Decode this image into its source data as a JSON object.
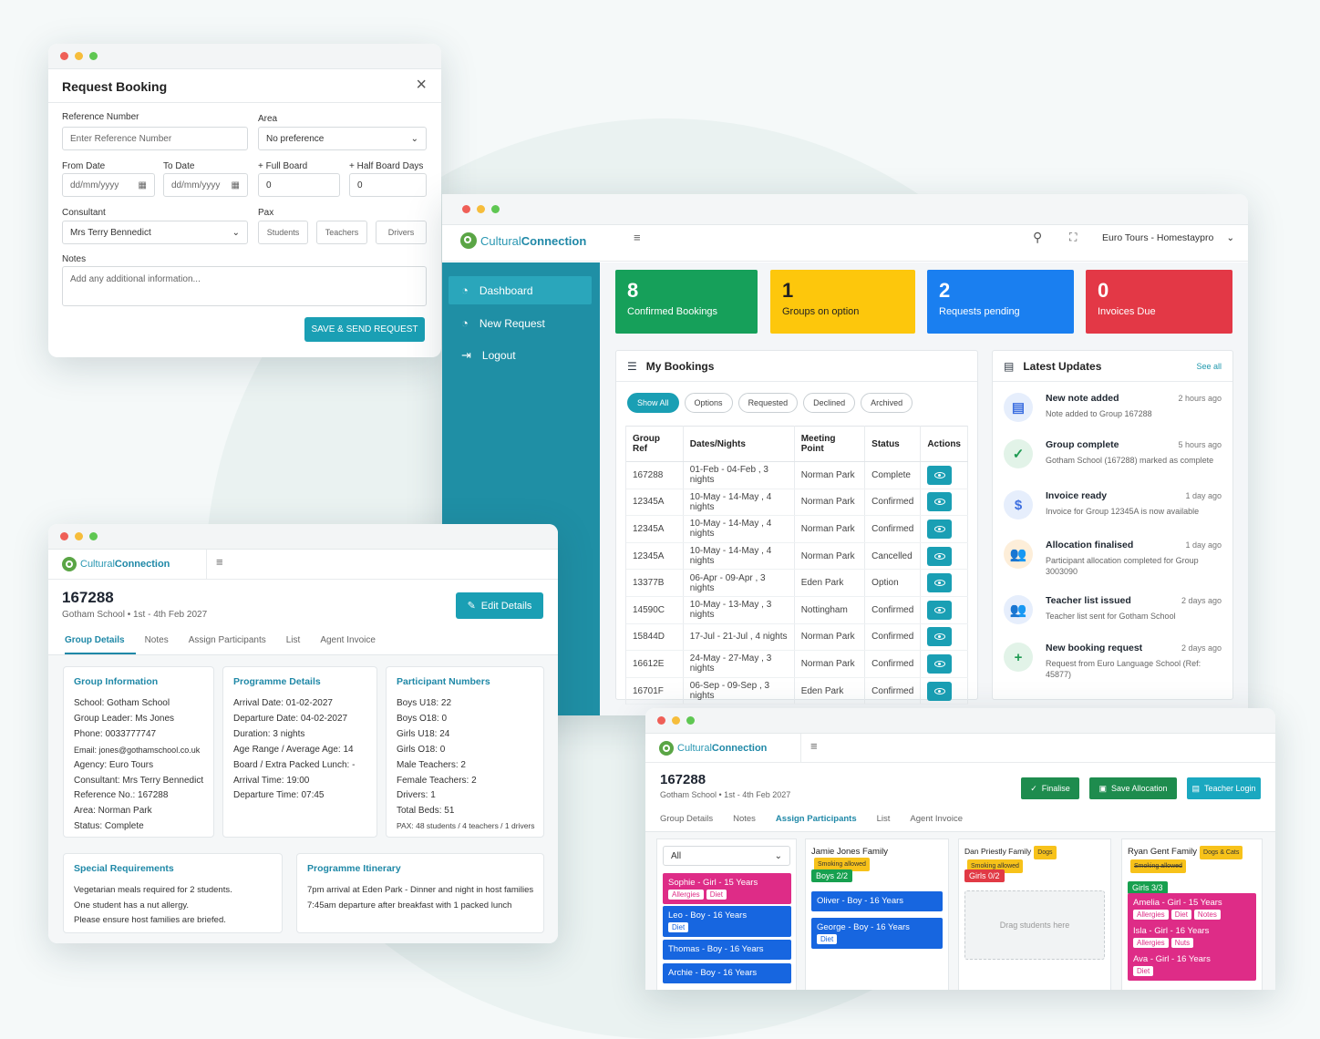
{
  "booking_form": {
    "title": "Request Booking",
    "ref_label": "Reference Number",
    "ref_placeholder": "Enter Reference Number",
    "area_label": "Area",
    "area_value": "No preference",
    "from_label": "From Date",
    "from_placeholder": "dd/mm/yyyy",
    "to_label": "To Date",
    "to_placeholder": "dd/mm/yyyy",
    "full_board_label": "+ Full Board",
    "full_board_value": "0",
    "half_board_label": "+ Half Board Days",
    "half_board_value": "0",
    "consultant_label": "Consultant",
    "consultant_value": "Mrs Terry Bennedict",
    "pax_label": "Pax",
    "pax_students": "Students",
    "pax_teachers": "Teachers",
    "pax_drivers": "Drivers",
    "notes_label": "Notes",
    "notes_placeholder": "Add any additional information...",
    "submit": "SAVE & SEND REQUEST"
  },
  "brand": {
    "part1": "Cultural",
    "part2": "Connection"
  },
  "dashboard": {
    "account": "Euro Tours - Homestaypro",
    "nav": [
      "Dashboard",
      "New Request",
      "Logout"
    ],
    "stats": [
      {
        "value": "8",
        "label": "Confirmed Bookings",
        "color": "#16a05a"
      },
      {
        "value": "1",
        "label": "Groups on option",
        "color": "#fdc70c"
      },
      {
        "value": "2",
        "label": "Requests pending",
        "color": "#1a7ff0"
      },
      {
        "value": "0",
        "label": "Invoices Due",
        "color": "#e33846"
      }
    ],
    "bookings_title": "My Bookings",
    "filters": [
      "Show All",
      "Options",
      "Requested",
      "Declined",
      "Archived"
    ],
    "columns": [
      "Group Ref",
      "Dates/Nights",
      "Meeting Point",
      "Status",
      "Actions"
    ],
    "rows": [
      [
        "167288",
        "01-Feb - 04-Feb , 3 nights",
        "Norman Park",
        "Complete"
      ],
      [
        "12345A",
        "10-May - 14-May , 4 nights",
        "Norman Park",
        "Confirmed"
      ],
      [
        "12345A",
        "10-May - 14-May , 4 nights",
        "Norman Park",
        "Confirmed"
      ],
      [
        "12345A",
        "10-May - 14-May , 4 nights",
        "Norman Park",
        "Cancelled"
      ],
      [
        "13377B",
        "06-Apr - 09-Apr , 3 nights",
        "Eden Park",
        "Option"
      ],
      [
        "14590C",
        "10-May - 13-May , 3 nights",
        "Nottingham",
        "Confirmed"
      ],
      [
        "15844D",
        "17-Jul - 21-Jul , 4 nights",
        "Norman Park",
        "Confirmed"
      ],
      [
        "16612E",
        "24-May - 27-May , 3 nights",
        "Norman Park",
        "Confirmed"
      ],
      [
        "16701F",
        "06-Sep - 09-Sep , 3 nights",
        "Eden Park",
        "Confirmed"
      ]
    ],
    "updates_title": "Latest Updates",
    "see_all": "See all",
    "updates": [
      {
        "title": "New note added",
        "time": "2 hours ago",
        "desc": "Note added to Group 167288",
        "icon": "document-icon"
      },
      {
        "title": "Group complete",
        "time": "5 hours ago",
        "desc": "Gotham School (167288) marked as complete",
        "icon": "check-icon"
      },
      {
        "title": "Invoice ready",
        "time": "1 day ago",
        "desc": "Invoice for Group 12345A is now available",
        "icon": "invoice-icon"
      },
      {
        "title": "Allocation finalised",
        "time": "1 day ago",
        "desc": "Participant allocation completed for Group 3003090",
        "icon": "people-icon"
      },
      {
        "title": "Teacher list issued",
        "time": "2 days ago",
        "desc": "Teacher list sent for Gotham School",
        "icon": "people-icon"
      },
      {
        "title": "New booking request",
        "time": "2 days ago",
        "desc": "Request from Euro Language School (Ref: 45877)",
        "icon": "plus-icon"
      }
    ]
  },
  "group": {
    "ref": "167288",
    "subtitle": "Gotham School • 1st - 4th Feb 2027",
    "edit_button": "Edit Details",
    "tabs": [
      "Group Details",
      "Notes",
      "Assign Participants",
      "List",
      "Agent Invoice"
    ],
    "info_title": "Group Information",
    "info": [
      "School: Gotham School",
      "Group Leader: Ms Jones",
      "Phone: 0033777747",
      "Email: jones@gothamschool.co.uk",
      "Agency: Euro Tours",
      "Consultant: Mrs Terry Bennedict",
      "Reference No.: 167288",
      "Area: Norman Park",
      "Status: Complete"
    ],
    "programme_title": "Programme Details",
    "programme": [
      "Arrival Date: 01-02-2027",
      "Departure Date: 04-02-2027",
      "Duration: 3 nights",
      "Age Range / Average Age:  14",
      "Board / Extra Packed Lunch: -",
      "Arrival Time: 19:00",
      "Departure Time: 07:45"
    ],
    "participants_title": "Participant Numbers",
    "participants": [
      "Boys U18: 22",
      "Boys O18: 0",
      "Girls U18: 24",
      "Girls O18: 0",
      "Male Teachers: 2",
      "Female Teachers: 2",
      "Drivers: 1",
      "Total Beds: 51"
    ],
    "pax_note": "PAX: 48 students / 4 teachers / 1 drivers",
    "special_title": "Special Requirements",
    "special": [
      "Vegetarian meals required for 2 students.",
      "One student has a nut allergy.",
      "Please ensure host families are briefed."
    ],
    "itinerary_title": "Programme Itinerary",
    "itinerary": [
      "7pm arrival at Eden Park - Dinner and night in host families",
      "7:45am departure after breakfast with 1 packed lunch"
    ]
  },
  "assign": {
    "ref": "167288",
    "subtitle": "Gotham School • 1st - 4th Feb 2027",
    "finalise": "Finalise",
    "save": "Save Allocation",
    "teacher_login": "Teacher Login",
    "tabs": [
      "Group Details",
      "Notes",
      "Assign Participants",
      "List",
      "Agent Invoice"
    ],
    "filter": "All",
    "pool": [
      {
        "name": "Sophie - Girl - 15 Years",
        "tags": [
          "Allergies",
          "Diet"
        ]
      },
      {
        "name": "Leo - Boy - 16 Years",
        "tags": [
          "Diet"
        ]
      },
      {
        "name": "Thomas - Boy - 16 Years",
        "tags": []
      },
      {
        "name": "Archie - Boy - 16 Years",
        "tags": []
      }
    ],
    "families": [
      {
        "name": "Jamie Jones Family",
        "chips": [
          "Smoking allowed"
        ],
        "count": "Boys 2/2",
        "count_color": "#17a04f",
        "students": [
          {
            "name": "Oliver - Boy - 16 Years",
            "tags": []
          },
          {
            "name": "George - Boy - 16 Years",
            "tags": [
              "Diet"
            ]
          }
        ]
      },
      {
        "name": "Dan Priestly Family",
        "chips": [
          "Dogs",
          "Smoking allowed"
        ],
        "count": "Girls 0/2",
        "count_color": "#e13a45",
        "drop": "Drag students here",
        "students": []
      },
      {
        "name": "Ryan Gent Family",
        "chips": [
          "Dogs & Cats",
          "Smoking allowed"
        ],
        "count": "Girls 3/3",
        "count_color": "#17a04f",
        "students": [
          {
            "name": "Amelia - Girl - 15 Years",
            "tags": [
              "Allergies",
              "Diet",
              "Notes"
            ]
          },
          {
            "name": "Isla - Girl - 16 Years",
            "tags": [
              "Allergies",
              "Nuts"
            ]
          },
          {
            "name": "Ava - Girl - 16 Years",
            "tags": [
              "Diet"
            ]
          }
        ]
      }
    ]
  }
}
